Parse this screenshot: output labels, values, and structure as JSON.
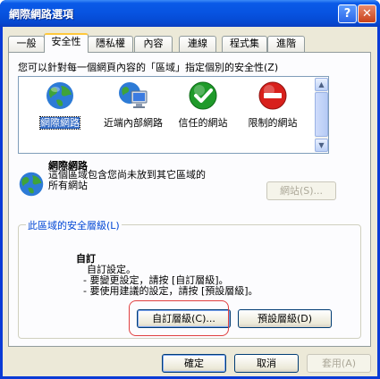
{
  "window": {
    "title": "網際網路選項",
    "help_glyph": "?",
    "close_glyph": "✕"
  },
  "tabs": [
    {
      "label": "一般"
    },
    {
      "label": "安全性",
      "active": true
    },
    {
      "label": "隱私權"
    },
    {
      "label": "內容"
    },
    {
      "label": "連線"
    },
    {
      "label": "程式集"
    },
    {
      "label": "進階"
    }
  ],
  "zones_prompt": "您可以針對每一個網頁內容的「區域」指定個別的安全性(Z)",
  "zones": [
    {
      "label": "網際網路",
      "icon": "globe-icon",
      "selected": true
    },
    {
      "label": "近端內部網路",
      "icon": "intranet-computer-icon"
    },
    {
      "label": "信任的網站",
      "icon": "trusted-checkmark-icon"
    },
    {
      "label": "限制的網站",
      "icon": "restricted-no-entry-icon"
    }
  ],
  "zone_info": {
    "name": "網際網路",
    "description": "這個區域包含您尚未放到其它區域的所有網站",
    "sites_button": "網站(S)..."
  },
  "security_level": {
    "group_label": "此區域的安全層級(L)",
    "level_name": "自訂",
    "lines": [
      "自訂設定。",
      "- 要變更設定，請按 [自訂層級]。",
      "- 要使用建議的設定，請按 [預設層級]。"
    ],
    "custom_button": "自訂層級(C)...",
    "default_button": "預設層級(D)"
  },
  "footer": {
    "ok": "確定",
    "cancel": "取消",
    "apply": "套用(A)"
  },
  "colors": {
    "titlebar": "#0753e0",
    "selection": "#316ac5",
    "highlight_circle": "#e04040",
    "group_title": "#0046d5"
  }
}
